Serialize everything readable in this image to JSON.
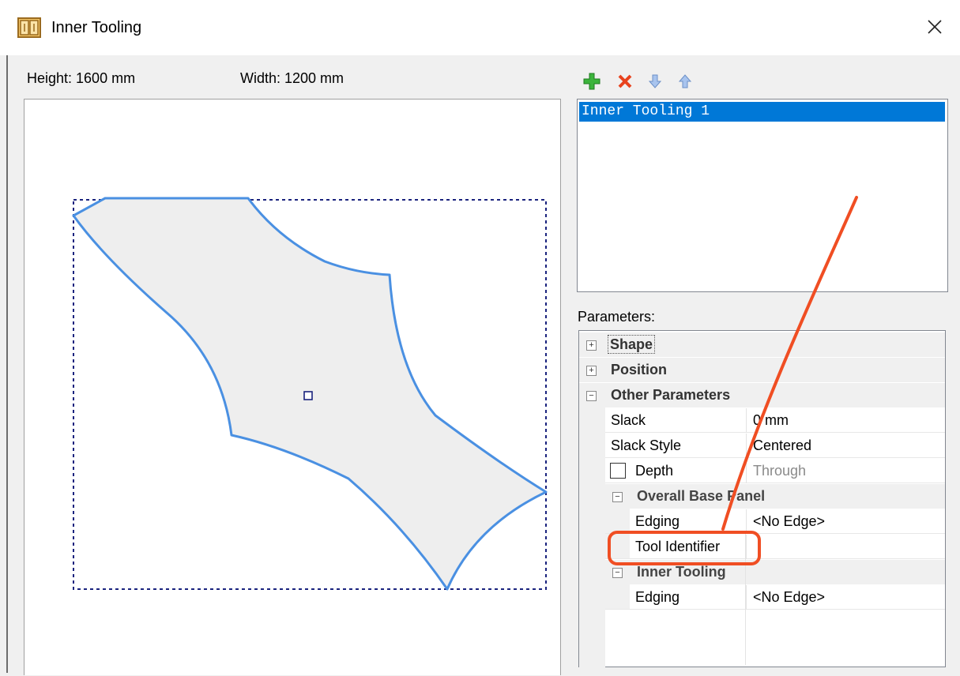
{
  "window": {
    "title": "Inner Tooling",
    "icon": "cabinet-icon",
    "close_icon": "close-icon"
  },
  "dimensions": {
    "height_label": "Height: 1600 mm",
    "width_label": "Width: 1200 mm"
  },
  "toolbar": {
    "add_icon": "green-plus-icon",
    "delete_icon": "red-x-icon",
    "down_icon": "arrow-down-icon",
    "up_icon": "arrow-up-icon"
  },
  "tooling_list": {
    "items": [
      "Inner Tooling 1"
    ],
    "selected": "Inner Tooling 1"
  },
  "parameters": {
    "label": "Parameters:",
    "categories": {
      "shape": "Shape",
      "position": "Position",
      "other": "Other Parameters",
      "overall_base_panel": "Overall Base Panel",
      "inner_tooling": "Inner Tooling"
    },
    "slack": {
      "name": "Slack",
      "value": "0 mm"
    },
    "slack_style": {
      "name": "Slack Style",
      "value": "Centered"
    },
    "depth": {
      "name": "Depth",
      "value": "Through",
      "checked": false
    },
    "obp_edging": {
      "name": "Edging",
      "value": "<No Edge>"
    },
    "tool_identifier": {
      "name": "Tool Identifier",
      "value": ""
    },
    "it_edging": {
      "name": "Edging",
      "value": "<No Edge>"
    }
  },
  "annotation": {
    "color": "#f04e23"
  },
  "colors": {
    "shape_stroke": "#4a90e2",
    "shape_fill": "#eeeeee",
    "selection": "#0078d7"
  }
}
